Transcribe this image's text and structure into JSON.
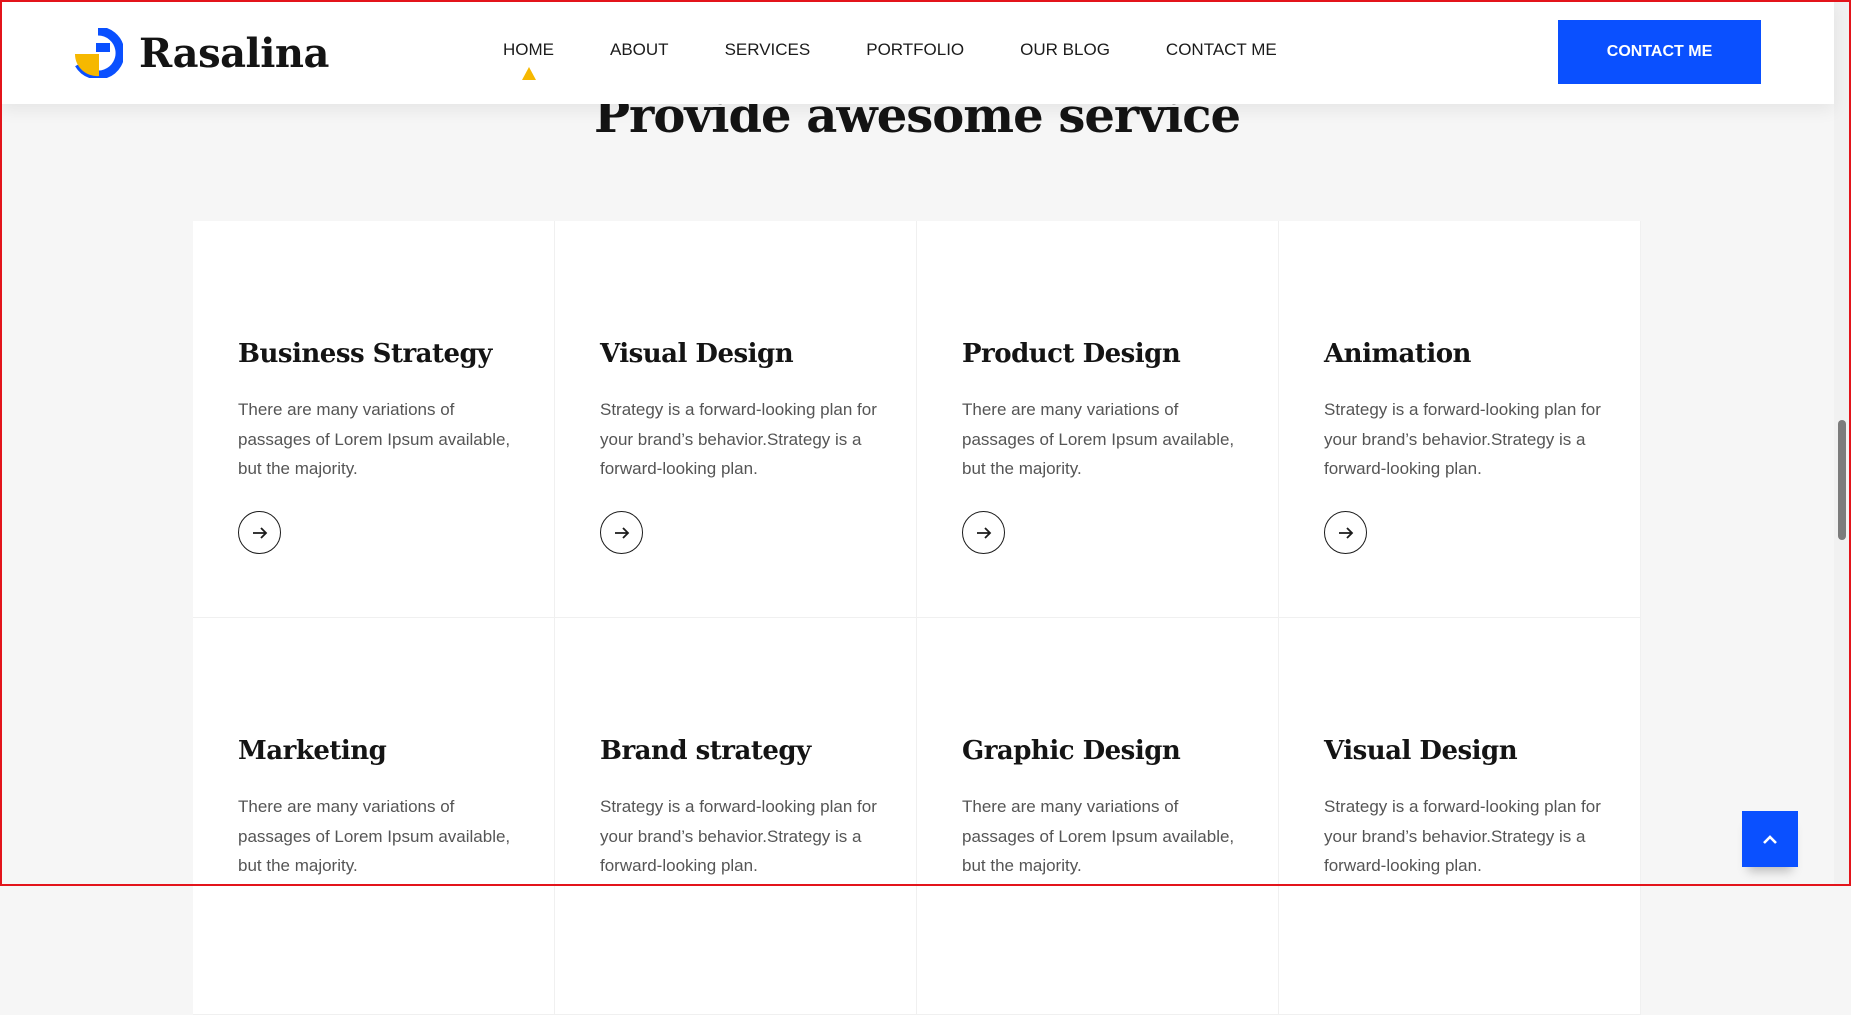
{
  "brand": {
    "name": "Rasalina",
    "logo_icon": "rasalina-logo-icon",
    "colors": {
      "primary": "#0a50ff",
      "accent": "#f6b800"
    }
  },
  "nav": {
    "items": [
      {
        "label": "HOME",
        "active": true
      },
      {
        "label": "ABOUT"
      },
      {
        "label": "SERVICES"
      },
      {
        "label": "PORTFOLIO"
      },
      {
        "label": "OUR BLOG"
      },
      {
        "label": "CONTACT ME"
      }
    ]
  },
  "header": {
    "cta_label": "CONTACT ME"
  },
  "services": {
    "title": "Provide awesome service",
    "cards": [
      {
        "title": "Business Strategy",
        "text": "There are many variations of passages of Lorem Ipsum available, but the majority.",
        "icon": "arrow-right-icon"
      },
      {
        "title": "Visual Design",
        "text": "Strategy is a forward-looking plan for your brand’s behavior.Strategy is a forward-looking plan.",
        "icon": "arrow-right-icon"
      },
      {
        "title": "Product Design",
        "text": "There are many variations of passages of Lorem Ipsum available, but the majority.",
        "icon": "arrow-right-icon"
      },
      {
        "title": "Animation",
        "text": "Strategy is a forward-looking plan for your brand’s behavior.Strategy is a forward-looking plan.",
        "icon": "arrow-right-icon"
      },
      {
        "title": "Marketing",
        "text": "There are many variations of passages of Lorem Ipsum available, but the majority."
      },
      {
        "title": "Brand strategy",
        "text": "Strategy is a forward-looking plan for your brand’s behavior.Strategy is a forward-looking plan."
      },
      {
        "title": "Graphic Design",
        "text": "There are many variations of passages of Lorem Ipsum available, but the majority."
      },
      {
        "title": "Visual Design",
        "text": "Strategy is a forward-looking plan for your brand’s behavior.Strategy is a forward-looking plan."
      }
    ]
  },
  "scroll_to_top": {
    "icon": "chevron-up-icon"
  }
}
